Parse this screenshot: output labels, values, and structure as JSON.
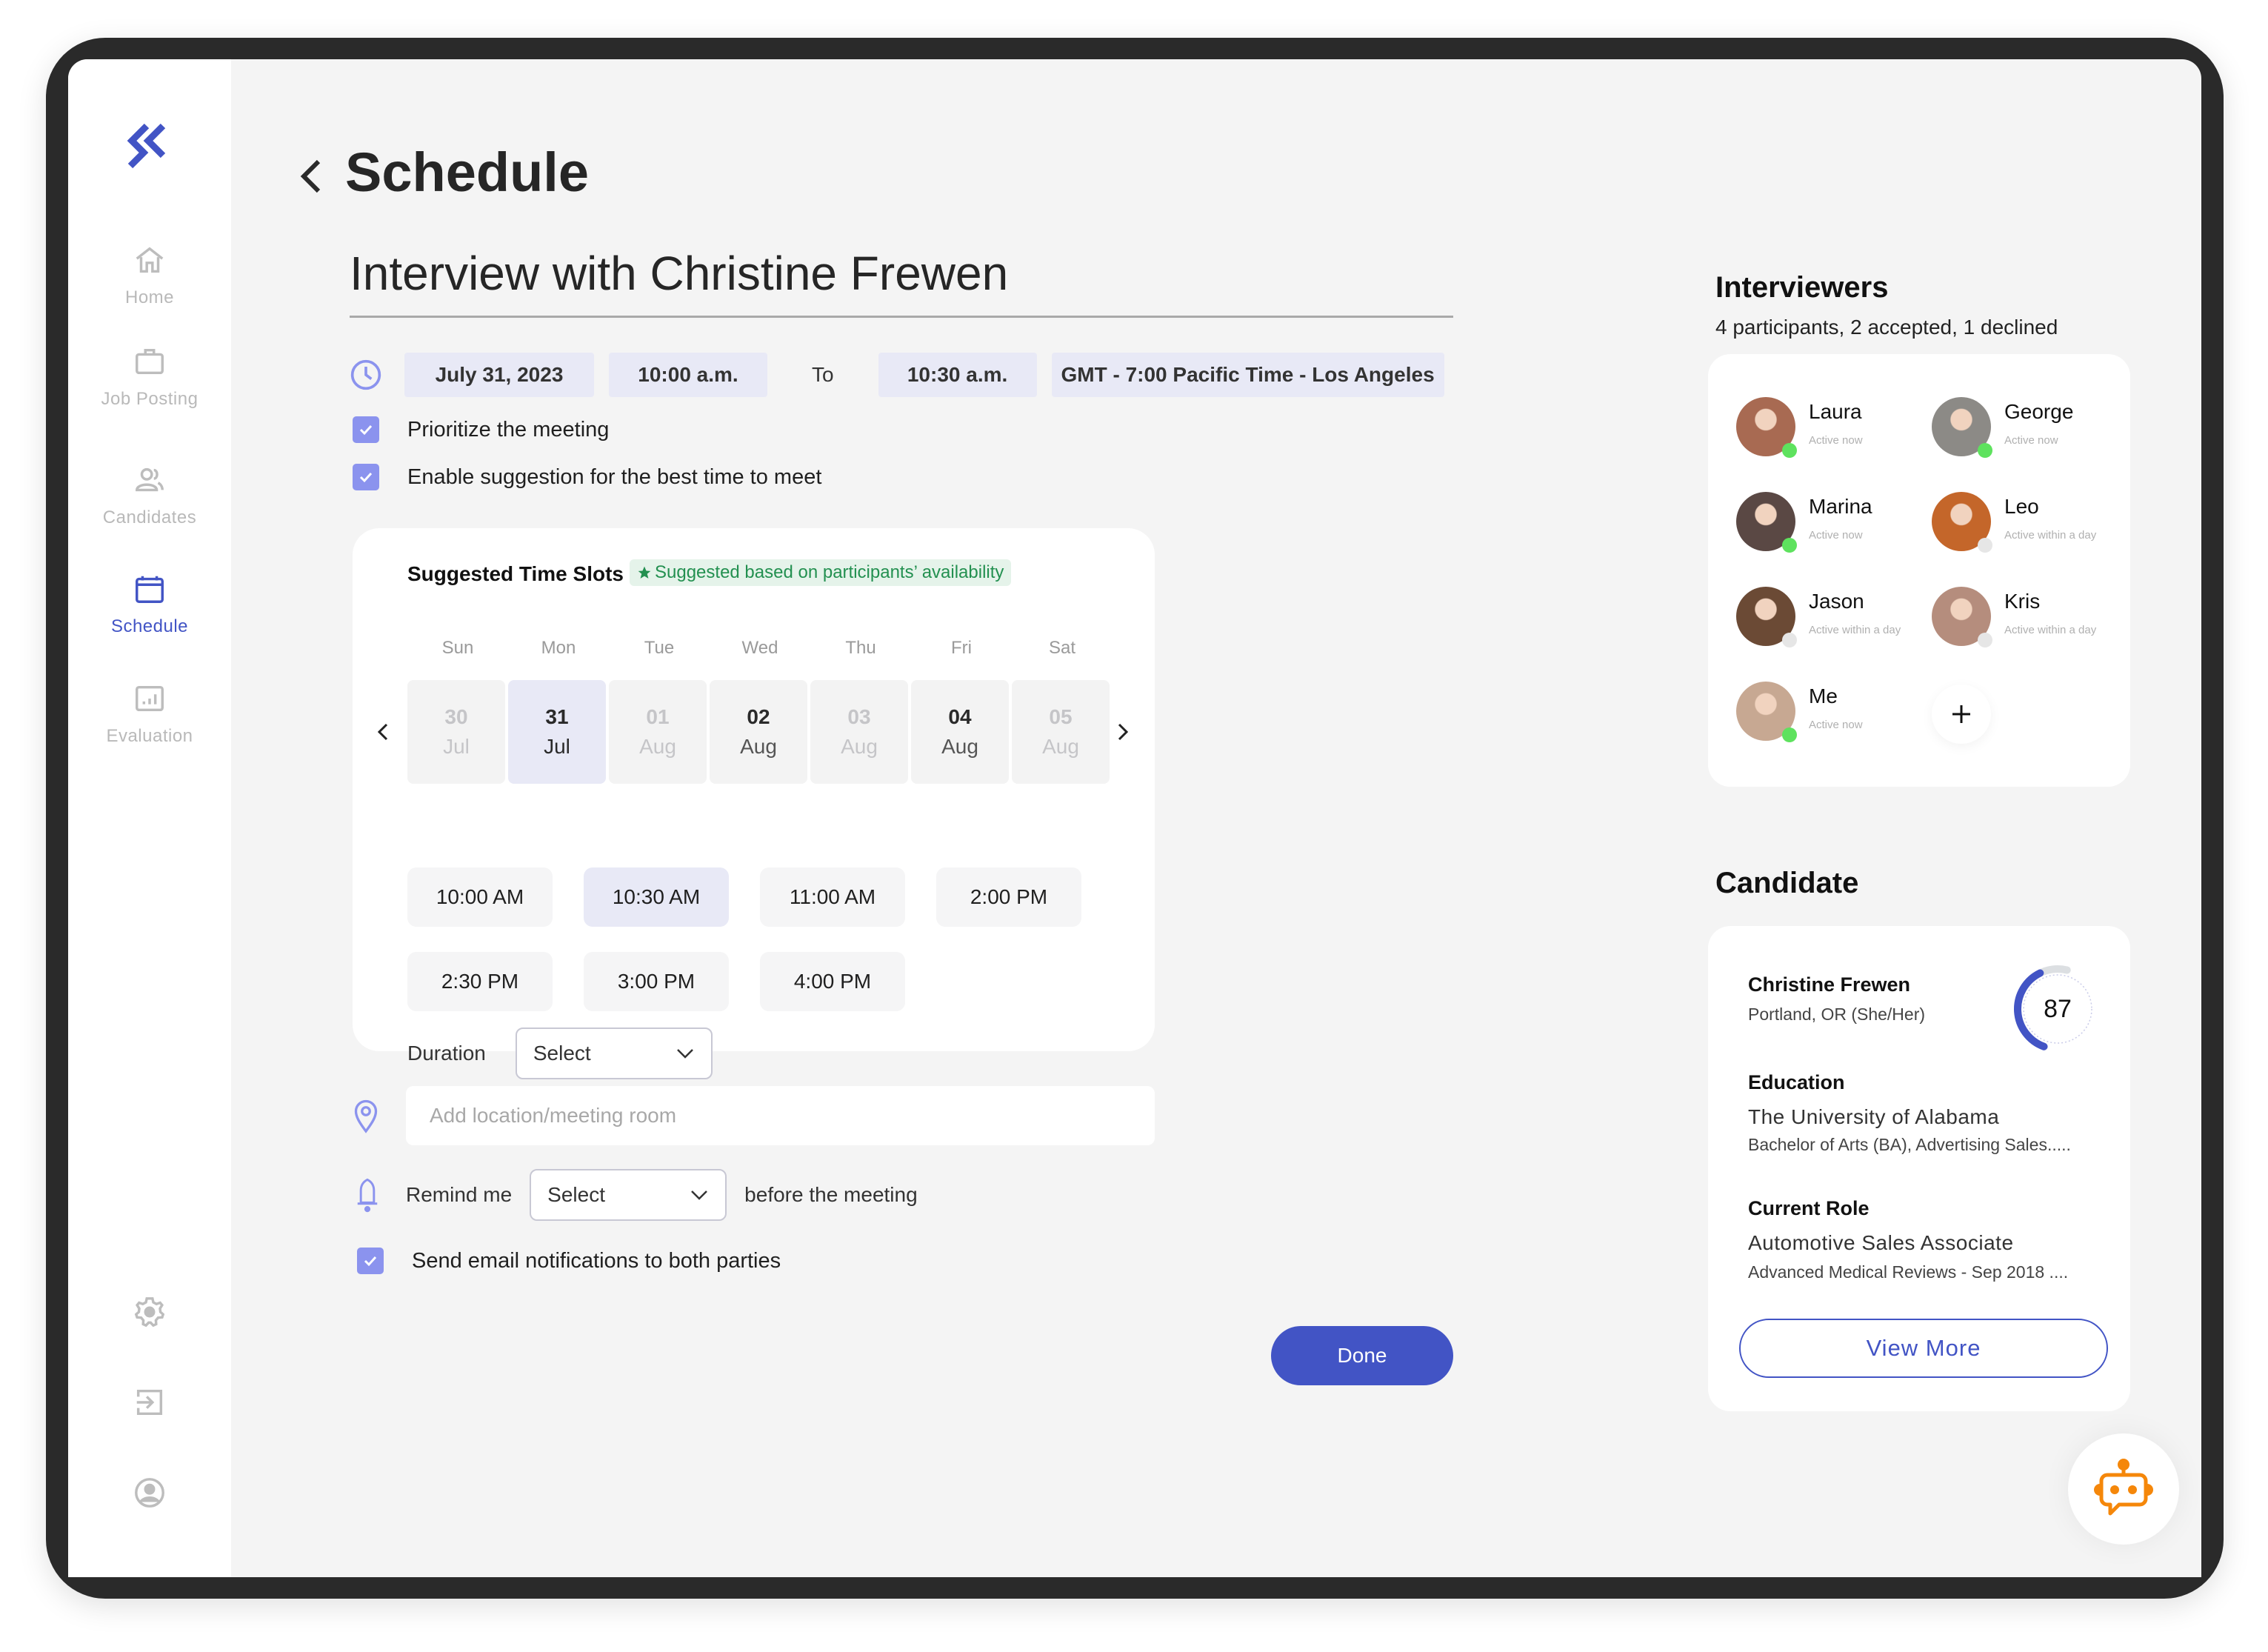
{
  "sidebar": {
    "items": [
      {
        "id": "home",
        "label": "Home",
        "icon": "home-icon",
        "active": false
      },
      {
        "id": "job-posting",
        "label": "Job Posting",
        "icon": "briefcase-icon",
        "active": false
      },
      {
        "id": "candidates",
        "label": "Candidates",
        "icon": "people-icon",
        "active": false
      },
      {
        "id": "schedule",
        "label": "Schedule",
        "icon": "calendar-icon",
        "active": true
      },
      {
        "id": "evaluation",
        "label": "Evaluation",
        "icon": "chart-icon",
        "active": false
      }
    ],
    "bottom_icons": [
      "gear-icon",
      "logout-icon",
      "profile-icon"
    ]
  },
  "header": {
    "title": "Schedule"
  },
  "meeting": {
    "title": "Interview with Christine Frewen",
    "date": "July 31, 2023",
    "start_time": "10:00 a.m.",
    "to_label": "To",
    "end_time": "10:30 a.m.",
    "timezone": "GMT - 7:00 Pacific Time - Los Angeles",
    "options": [
      {
        "label": "Prioritize the meeting",
        "checked": true
      },
      {
        "label": "Enable suggestion for the best time to meet",
        "checked": true
      }
    ]
  },
  "suggested": {
    "title": "Suggested Time Slots",
    "badge": "Suggested based on participants’ availability",
    "weekdays": [
      "Sun",
      "Mon",
      "Tue",
      "Wed",
      "Thu",
      "Fri",
      "Sat"
    ],
    "dates": [
      {
        "day": "30",
        "month": "Jul",
        "state": "disabled"
      },
      {
        "day": "31",
        "month": "Jul",
        "state": "selected"
      },
      {
        "day": "01",
        "month": "Aug",
        "state": "disabled"
      },
      {
        "day": "02",
        "month": "Aug",
        "state": "available"
      },
      {
        "day": "03",
        "month": "Aug",
        "state": "disabled"
      },
      {
        "day": "04",
        "month": "Aug",
        "state": "available"
      },
      {
        "day": "05",
        "month": "Aug",
        "state": "disabled"
      }
    ],
    "slots": [
      {
        "label": "10:00 AM",
        "selected": false
      },
      {
        "label": "10:30 AM",
        "selected": true
      },
      {
        "label": "11:00 AM",
        "selected": false
      },
      {
        "label": "2:00 PM",
        "selected": false
      },
      {
        "label": "2:30 PM",
        "selected": false
      },
      {
        "label": "3:00 PM",
        "selected": false
      },
      {
        "label": "4:00 PM",
        "selected": false
      }
    ],
    "duration_label": "Duration",
    "duration_value": "Select"
  },
  "location": {
    "placeholder": "Add location/meeting room",
    "value": ""
  },
  "reminder": {
    "label": "Remind me",
    "value": "Select",
    "suffix": "before the meeting"
  },
  "email_notify": {
    "label": "Send email notifications to both parties",
    "checked": true
  },
  "done_label": "Done",
  "interviewers": {
    "title": "Interviewers",
    "summary": "4 participants, 2 accepted, 1 declined",
    "people": [
      {
        "name": "Laura",
        "status": "Active now",
        "online": true,
        "color": "#a86a52"
      },
      {
        "name": "George",
        "status": "Active now",
        "online": true,
        "color": "#8c8a86"
      },
      {
        "name": "Marina",
        "status": "Active now",
        "online": true,
        "color": "#5a4844"
      },
      {
        "name": "Leo",
        "status": "Active within a day",
        "online": false,
        "color": "#c4662a"
      },
      {
        "name": "Jason",
        "status": "Active within a day",
        "online": false,
        "color": "#6b4a35"
      },
      {
        "name": "Kris",
        "status": "Active within a day",
        "online": false,
        "color": "#b58d7d"
      },
      {
        "name": "Me",
        "status": "Active now",
        "online": true,
        "color": "#c7a892"
      }
    ]
  },
  "candidate": {
    "title": "Candidate",
    "name": "Christine Frewen",
    "location": "Portland, OR (She/Her)",
    "score": 87,
    "education_label": "Education",
    "school": "The University of Alabama",
    "degree": "Bachelor of Arts (BA), Advertising Sales.....",
    "role_label": "Current Role",
    "role": "Automotive Sales Associate",
    "company": "Advanced Medical Reviews  - Sep 2018 ....",
    "view_more": "View More"
  },
  "colors": {
    "accent": "#4254c5",
    "checkbox": "#8b93ee",
    "chip": "#e8e9f6",
    "online": "#5ee25e",
    "badge_text": "#239050",
    "bot": "#f5870a"
  }
}
